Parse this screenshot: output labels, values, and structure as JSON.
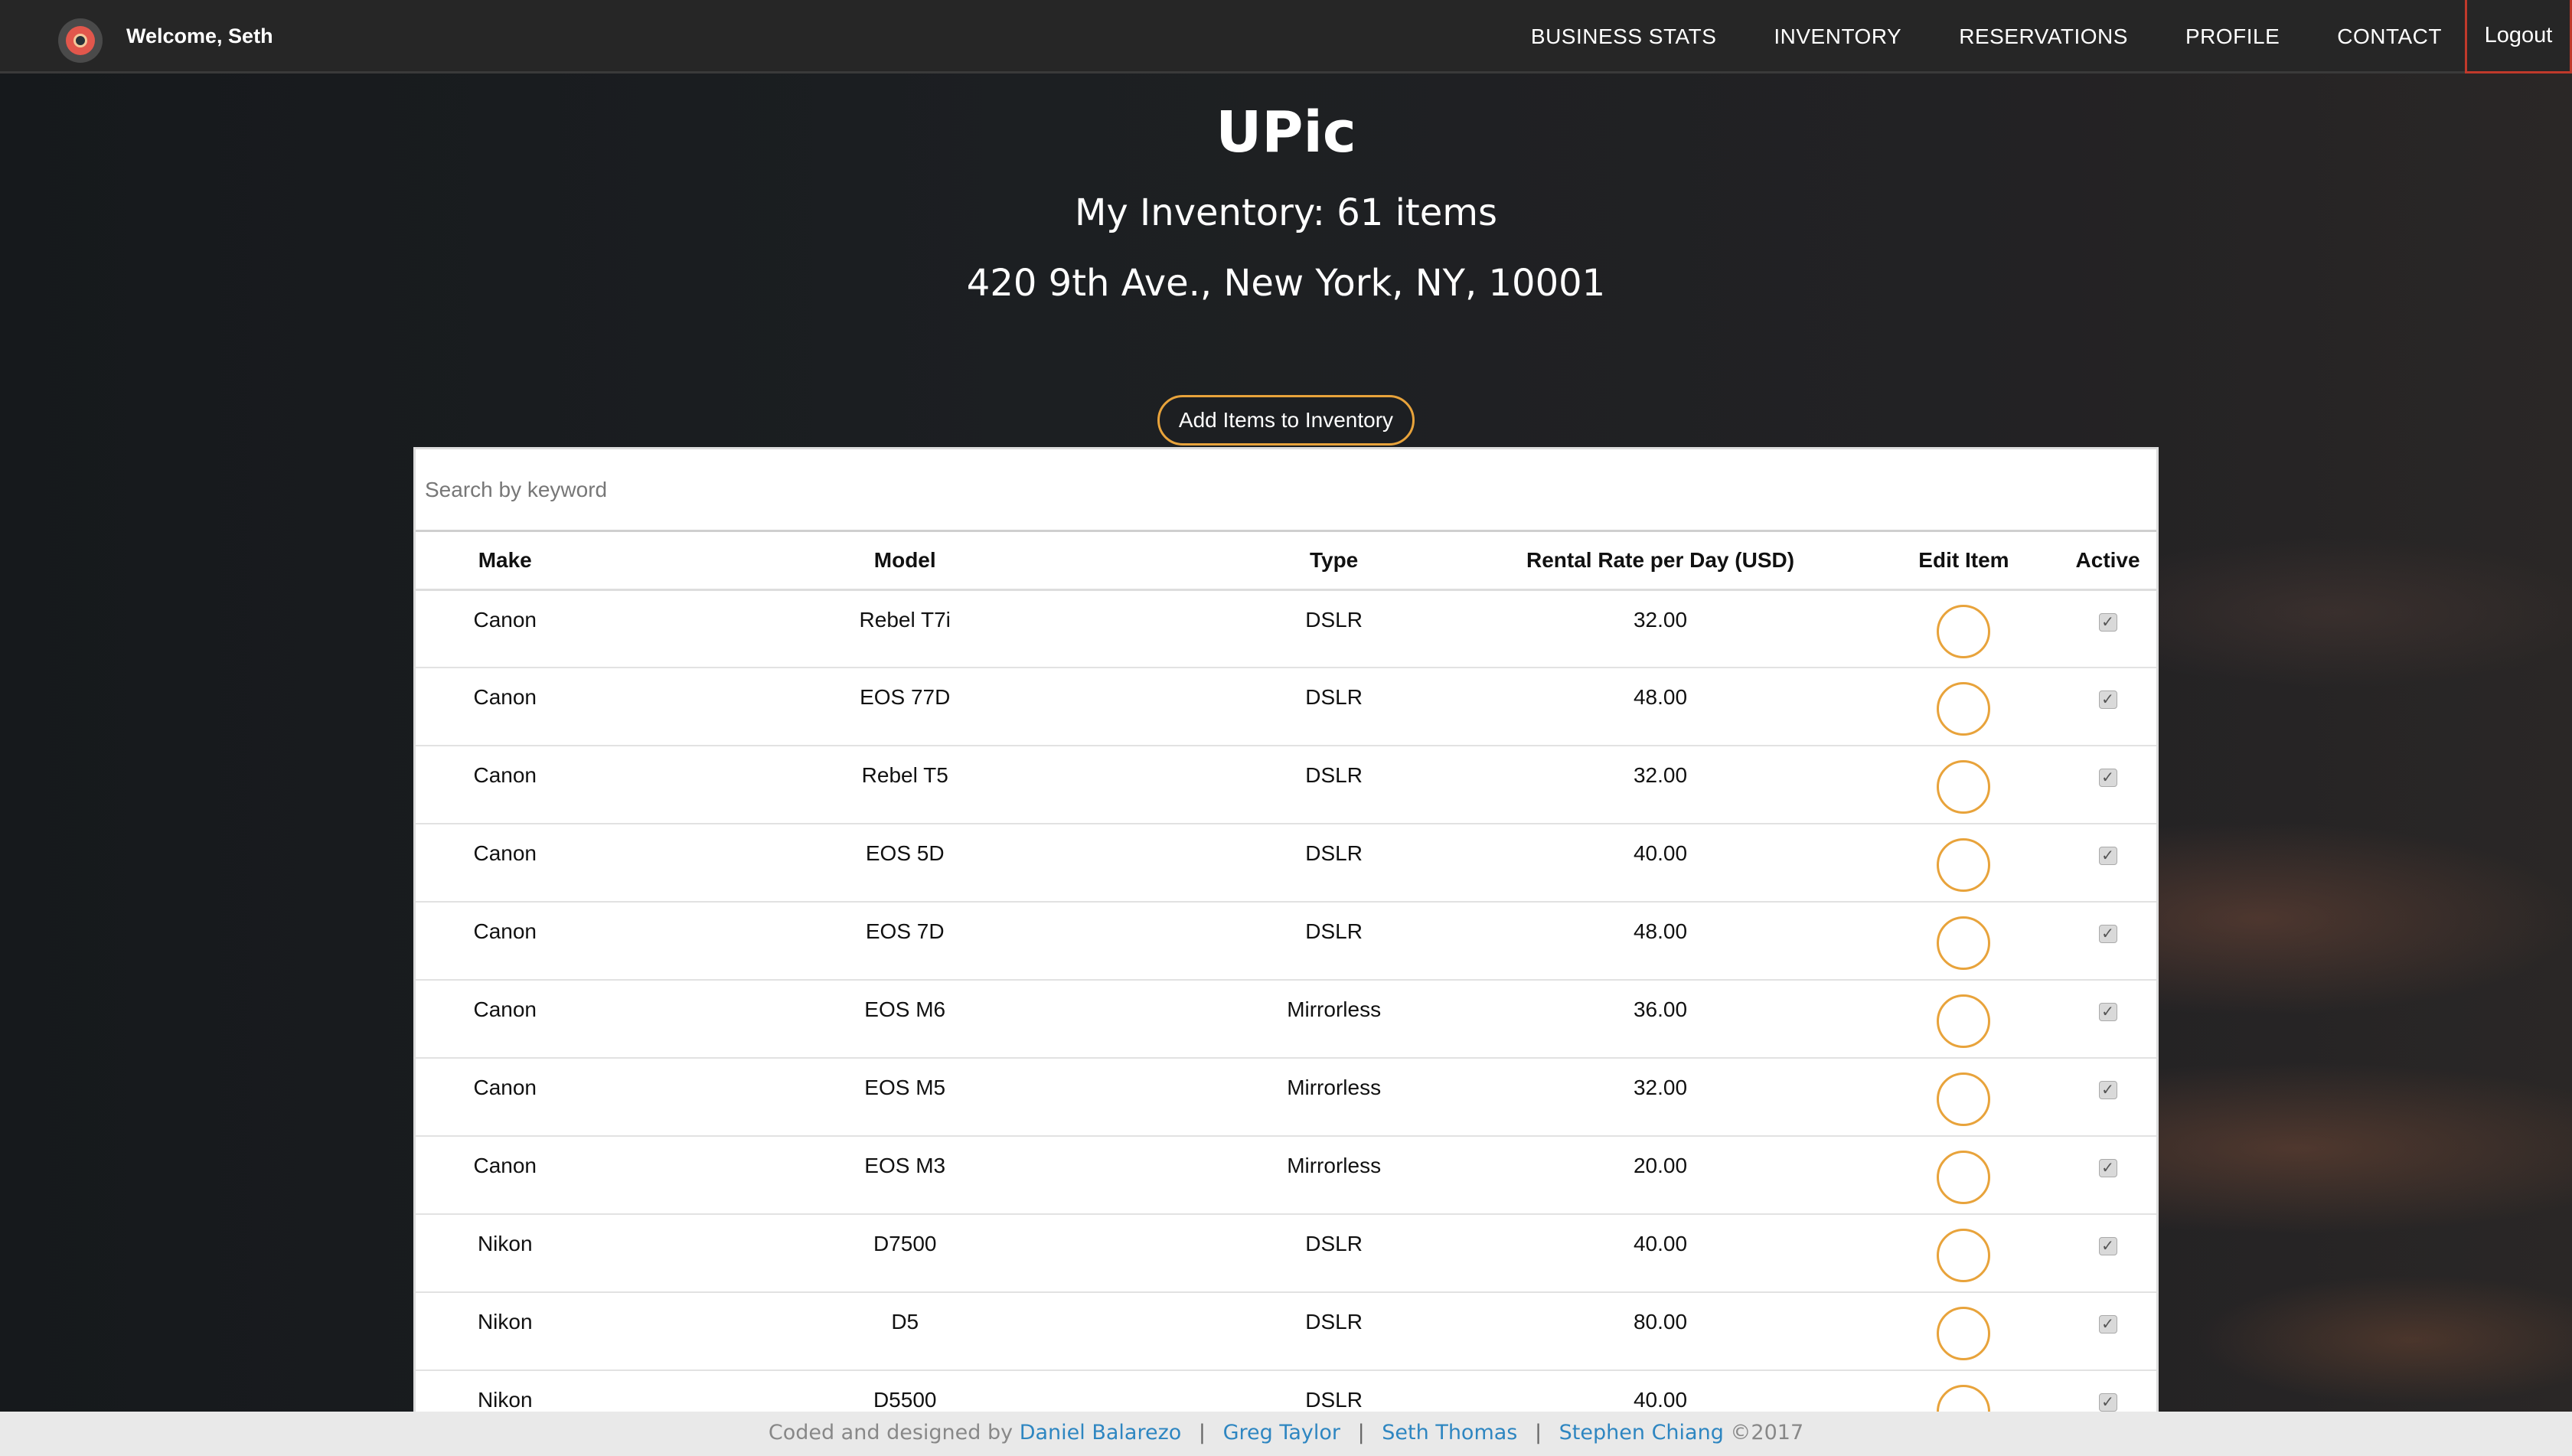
{
  "navbar": {
    "welcome": "Welcome, Seth",
    "links": [
      "BUSINESS STATS",
      "INVENTORY",
      "RESERVATIONS",
      "PROFILE",
      "CONTACT"
    ],
    "logout": "Logout"
  },
  "header": {
    "brand": "UPic",
    "subtitle": "My Inventory: 61 items",
    "address": "420 9th Ave., New York, NY, 10001"
  },
  "add_button": "Add Items to Inventory",
  "search": {
    "placeholder": "Search by keyword"
  },
  "table": {
    "headers": [
      "Make",
      "Model",
      "Type",
      "Rental Rate per Day (USD)",
      "Edit Item",
      "Active"
    ],
    "rows": [
      {
        "make": "Canon",
        "model": "Rebel T7i",
        "type": "DSLR",
        "rate": "32.00",
        "active": true
      },
      {
        "make": "Canon",
        "model": "EOS 77D",
        "type": "DSLR",
        "rate": "48.00",
        "active": true
      },
      {
        "make": "Canon",
        "model": "Rebel T5",
        "type": "DSLR",
        "rate": "32.00",
        "active": true
      },
      {
        "make": "Canon",
        "model": "EOS 5D",
        "type": "DSLR",
        "rate": "40.00",
        "active": true
      },
      {
        "make": "Canon",
        "model": "EOS 7D",
        "type": "DSLR",
        "rate": "48.00",
        "active": true
      },
      {
        "make": "Canon",
        "model": "EOS M6",
        "type": "Mirrorless",
        "rate": "36.00",
        "active": true
      },
      {
        "make": "Canon",
        "model": "EOS M5",
        "type": "Mirrorless",
        "rate": "32.00",
        "active": true
      },
      {
        "make": "Canon",
        "model": "EOS M3",
        "type": "Mirrorless",
        "rate": "20.00",
        "active": true
      },
      {
        "make": "Nikon",
        "model": "D7500",
        "type": "DSLR",
        "rate": "40.00",
        "active": true
      },
      {
        "make": "Nikon",
        "model": "D5",
        "type": "DSLR",
        "rate": "80.00",
        "active": true
      },
      {
        "make": "Nikon",
        "model": "D5500",
        "type": "DSLR",
        "rate": "40.00",
        "active": true
      }
    ]
  },
  "footer": {
    "prefix": "Coded and designed by",
    "authors": [
      "Daniel Balarezo",
      "Greg Taylor",
      "Seth Thomas",
      "Stephen Chiang"
    ],
    "separator": "|",
    "copyright": "©2017"
  },
  "colors": {
    "accent": "#e8a33b",
    "navbar": "#262626",
    "logout_border": "#c0392b",
    "link": "#2e86c1"
  }
}
